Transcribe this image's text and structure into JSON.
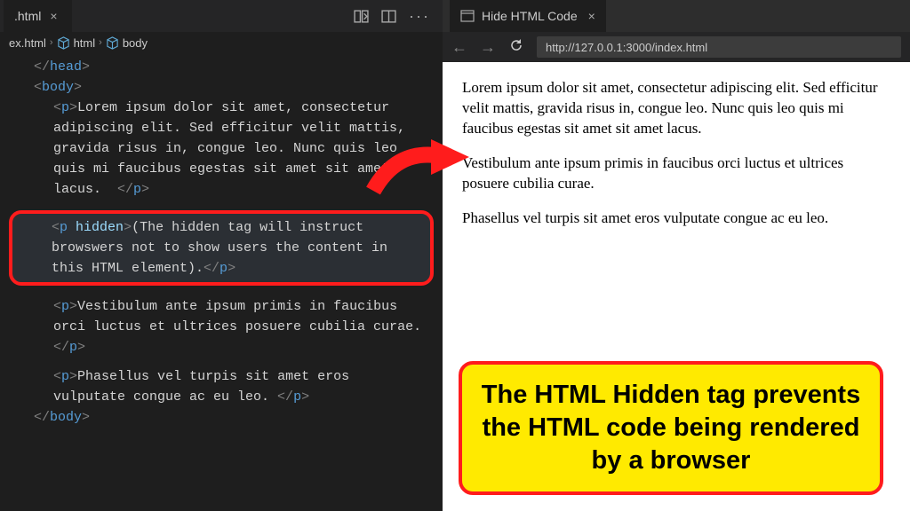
{
  "editor": {
    "tab": {
      "filename": ".html"
    },
    "breadcrumb": {
      "file": "ex.html",
      "path1": "html",
      "path2": "body"
    },
    "code": {
      "head_close": "head",
      "body_open": "body",
      "body_close": "body",
      "p": "p",
      "p_hidden_tag": "p",
      "p_hidden_attr": "hidden",
      "para1": "Lorem ipsum dolor sit amet, consectetur adipiscing elit. Sed efficitur velit mattis, gravida risus in, congue leo. Nunc quis leo quis mi faucibus egestas sit amet sit amet lacus.  ",
      "para_hidden": "(The hidden tag will instruct browswers not to show users the content in this HTML element).",
      "para2": "Vestibulum ante ipsum primis in faucibus orci luctus et ultrices posuere cubilia curae. ",
      "para3": "Phasellus vel turpis sit amet eros vulputate congue ac eu leo. "
    }
  },
  "browser": {
    "tab_title": "Hide HTML Code",
    "url": "http://127.0.0.1:3000/index.html",
    "content": {
      "p1": "Lorem ipsum dolor sit amet, consectetur adipiscing elit. Sed efficitur velit mattis, gravida risus in, congue leo. Nunc quis leo quis mi faucibus egestas sit amet sit amet lacus.",
      "p2": "Vestibulum ante ipsum primis in faucibus orci luctus et ultrices posuere cubilia curae.",
      "p3": "Phasellus vel turpis sit amet eros vulputate congue ac eu leo."
    }
  },
  "callout_text": "The HTML Hidden tag prevents the HTML code being rendered by a browser"
}
